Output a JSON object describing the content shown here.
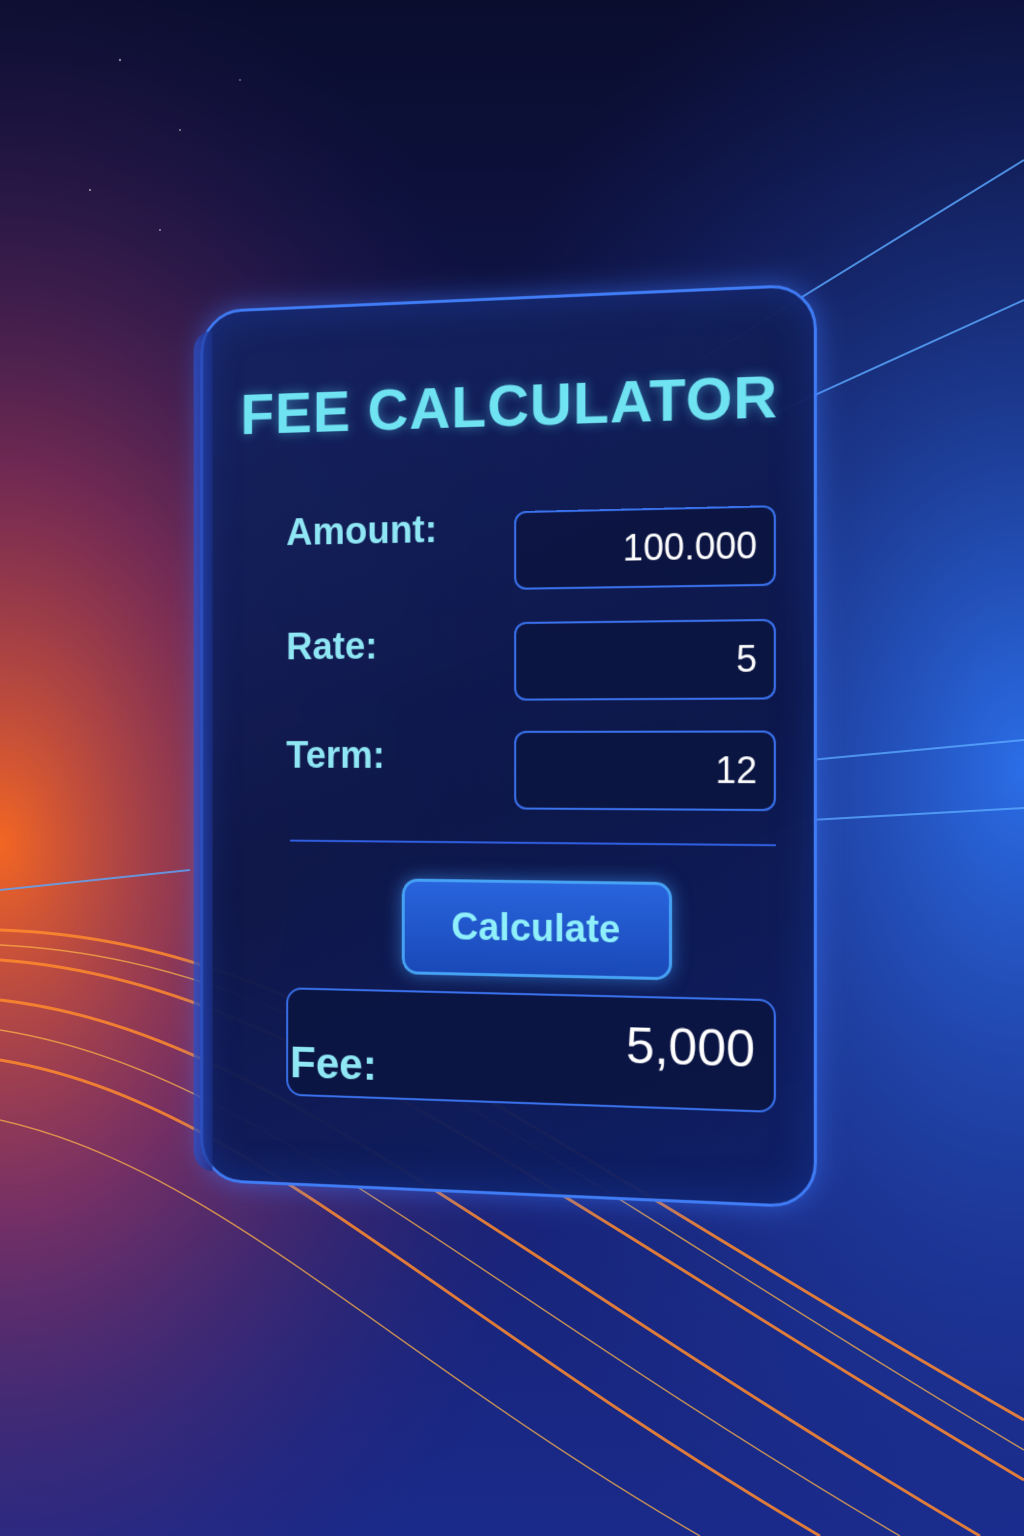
{
  "calculator": {
    "title": "FEE CALCULATOR",
    "fields": [
      {
        "label": "Amount:",
        "value": "100.000"
      },
      {
        "label": "Rate:",
        "value": "5"
      },
      {
        "label": "Term:",
        "value": "12"
      }
    ],
    "calculate_label": "Calculate",
    "result": {
      "label": "Fee:",
      "value": "5,000"
    }
  },
  "colors": {
    "accent": "#6fe3f2",
    "border": "#3f7cf5",
    "button": "#2864dd",
    "background": "#0b1038",
    "streak_warm": "#ff7a2a"
  }
}
